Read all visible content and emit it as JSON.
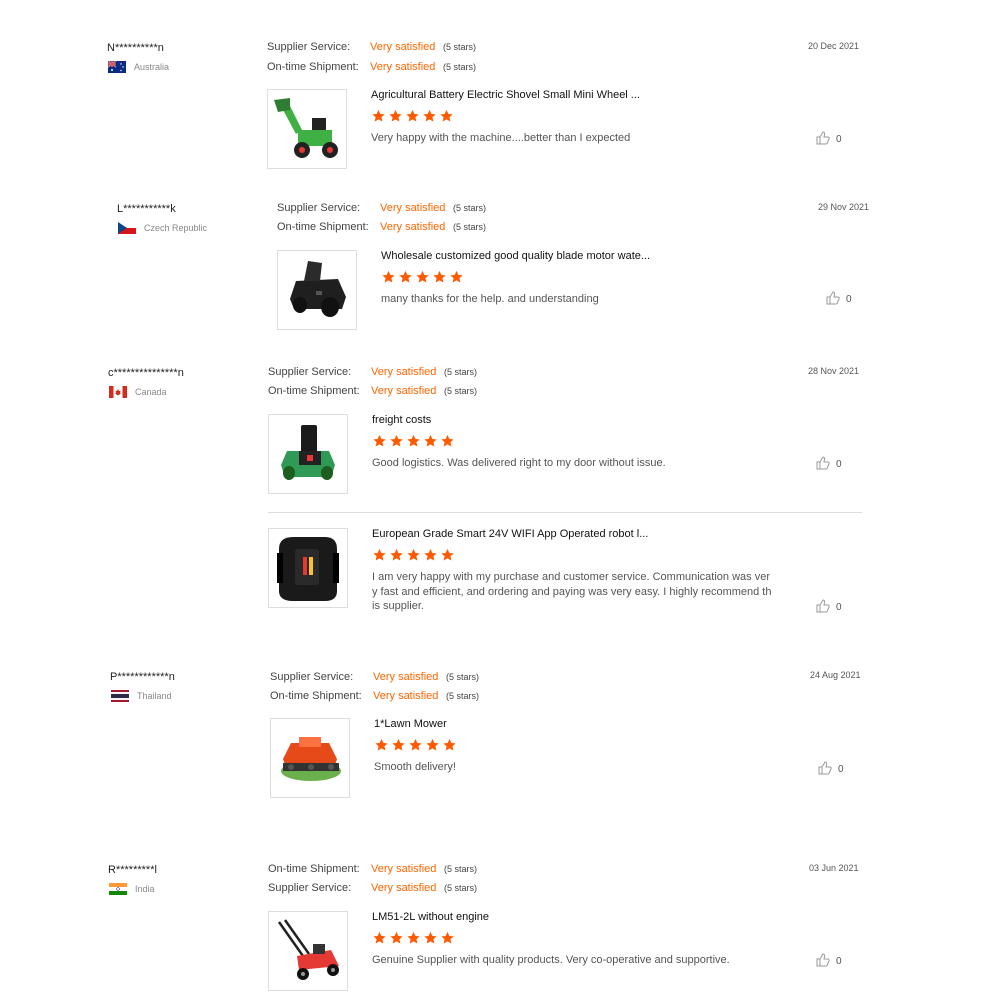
{
  "reviews": [
    {
      "user": "N**********n",
      "country": "Australia",
      "date": "20 Dec 2021",
      "ratings": [
        {
          "label": "Supplier Service:",
          "value": "Very satisfied",
          "stars": "(5 stars)"
        },
        {
          "label": "On-time Shipment:",
          "value": "Very satisfied",
          "stars": "(5 stars)"
        }
      ],
      "products": [
        {
          "title": "Agricultural Battery Electric Shovel Small Mini Wheel ...",
          "comment": "Very happy with the machine....better than I expected",
          "likes": "0",
          "image": "green-mini-loader"
        }
      ]
    },
    {
      "user": "L***********k",
      "country": "Czech Republic",
      "date": "29 Nov 2021",
      "ratings": [
        {
          "label": "Supplier Service:",
          "value": "Very satisfied",
          "stars": "(5 stars)"
        },
        {
          "label": "On-time Shipment:",
          "value": "Very satisfied",
          "stars": "(5 stars)"
        }
      ],
      "products": [
        {
          "title": "Wholesale customized good quality blade motor wate...",
          "comment": "many thanks for the help. and understanding",
          "likes": "0",
          "image": "black-robot-mower"
        }
      ]
    },
    {
      "user": "c***************n",
      "country": "Canada",
      "date": "28 Nov 2021",
      "ratings": [
        {
          "label": "Supplier Service:",
          "value": "Very satisfied",
          "stars": "(5 stars)"
        },
        {
          "label": "On-time Shipment:",
          "value": "Very satisfied",
          "stars": "(5 stars)"
        }
      ],
      "products": [
        {
          "title": "freight costs",
          "comment": "Good logistics. Was delivered right to my door without issue.",
          "likes": "0",
          "image": "green-robot-mower"
        },
        {
          "title": "European Grade Smart 24V WIFI App Operated robot l...",
          "comment": "I am very happy with my purchase and customer service. Communication was very fast and efficient, and ordering and paying was very easy. I highly recommend this supplier.",
          "likes": "0",
          "image": "black-robot-mower-top"
        }
      ]
    },
    {
      "user": "P************n",
      "country": "Thailand",
      "date": "24 Aug 2021",
      "ratings": [
        {
          "label": "Supplier Service:",
          "value": "Very satisfied",
          "stars": "(5 stars)"
        },
        {
          "label": "On-time Shipment:",
          "value": "Very satisfied",
          "stars": "(5 stars)"
        }
      ],
      "products": [
        {
          "title": "1*Lawn Mower",
          "comment": "Smooth delivery!",
          "likes": "0",
          "image": "orange-tracked-mower"
        }
      ]
    },
    {
      "user": "R*********l",
      "country": "India",
      "date": "03 Jun 2021",
      "ratings": [
        {
          "label": "On-time Shipment:",
          "value": "Very satisfied",
          "stars": "(5 stars)"
        },
        {
          "label": "Supplier Service:",
          "value": "Very satisfied",
          "stars": "(5 stars)"
        }
      ],
      "products": [
        {
          "title": "LM51-2L without engine",
          "comment": "Genuine Supplier with quality products. Very co-operative and supportive.",
          "likes": "0",
          "image": "red-push-mower"
        }
      ]
    }
  ],
  "colors": {
    "accent": "#ff6600",
    "star": "#ff5a00"
  },
  "icons": {
    "like": "thumbs-up-icon",
    "star": "star-icon"
  }
}
